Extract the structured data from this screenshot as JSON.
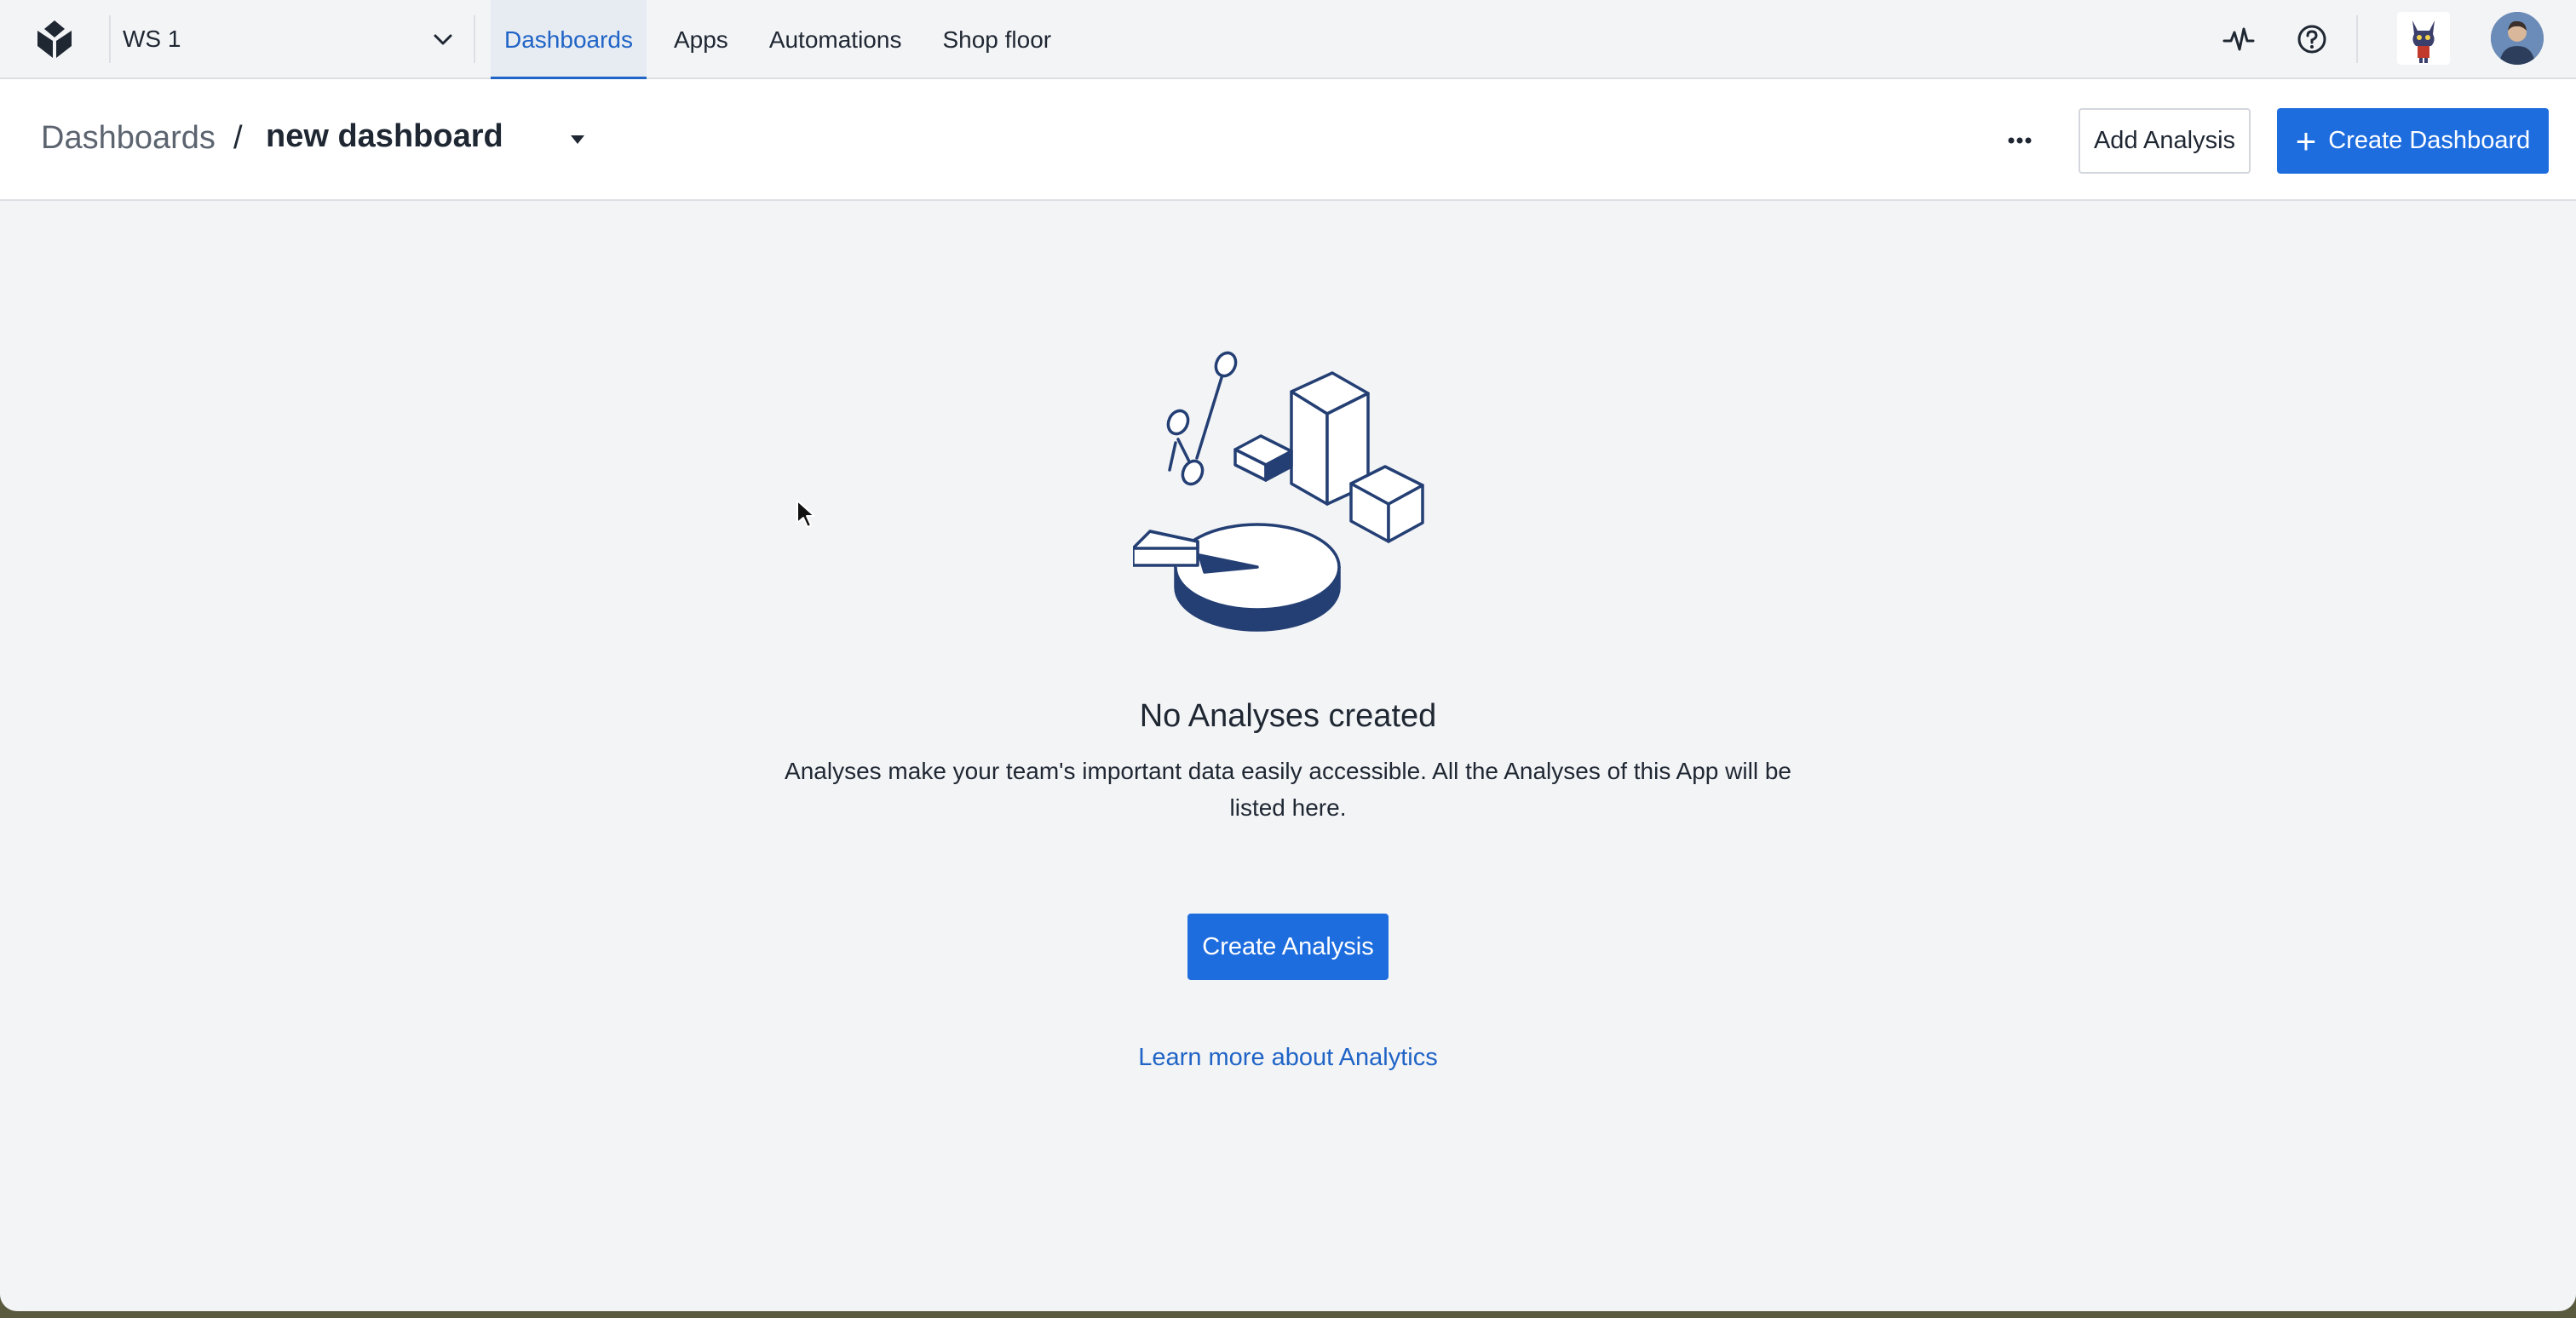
{
  "nav": {
    "workspace": "WS 1",
    "tabs": [
      {
        "label": "Dashboards",
        "active": true
      },
      {
        "label": "Apps",
        "active": false
      },
      {
        "label": "Automations",
        "active": false
      },
      {
        "label": "Shop floor",
        "active": false
      }
    ],
    "icons": [
      "activity-icon",
      "help-icon"
    ]
  },
  "header": {
    "breadcrumb_root": "Dashboards",
    "separator": "/",
    "dashboard_name": "new dashboard",
    "add_analysis_label": "Add Analysis",
    "create_dashboard_label": "Create Dashboard"
  },
  "empty_state": {
    "title": "No Analyses created",
    "description": "Analyses make your team's important data easily accessible. All the Analyses of this App will be listed here.",
    "create_button": "Create Analysis",
    "learn_more": "Learn more about Analytics"
  },
  "colors": {
    "accent": "#1e6ddf",
    "link": "#1f64c6",
    "illustration": "#243f74"
  }
}
